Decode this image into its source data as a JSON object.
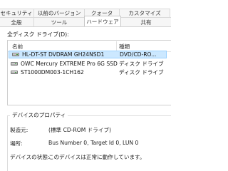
{
  "tabs_row1": [
    "セキュリティ",
    "以前のバージョン",
    "クォータ",
    "カスタマイズ"
  ],
  "tabs_row2": [
    "全般",
    "ツール",
    "ハードウェア",
    "共有"
  ],
  "active_tab": "ハードウェア",
  "drives_section": {
    "label": "全ディスク ドライブ(D):",
    "columns": {
      "name": "名前",
      "type": "種類"
    },
    "rows": [
      {
        "name": "HL-DT-ST DVDRAM GH24NSD1",
        "type": "DVD/CD-RO..."
      },
      {
        "name": "OWC Mercury EXTREME Pro 6G SSD",
        "type": "ディスク ドライブ"
      },
      {
        "name": "ST1000DM003-1CH162",
        "type": "ディスク ドライブ"
      }
    ]
  },
  "properties": {
    "title": "デバイスのプロパティ",
    "manufacturer_label": "製造元:",
    "manufacturer_value": "(標準 CD-ROM ドライブ)",
    "location_label": "場所:",
    "location_value": "Bus Number 0, Target Id 0, LUN 0",
    "status_label": "デバイスの状態:",
    "status_value": "このデバイスは正常に動作しています。"
  }
}
